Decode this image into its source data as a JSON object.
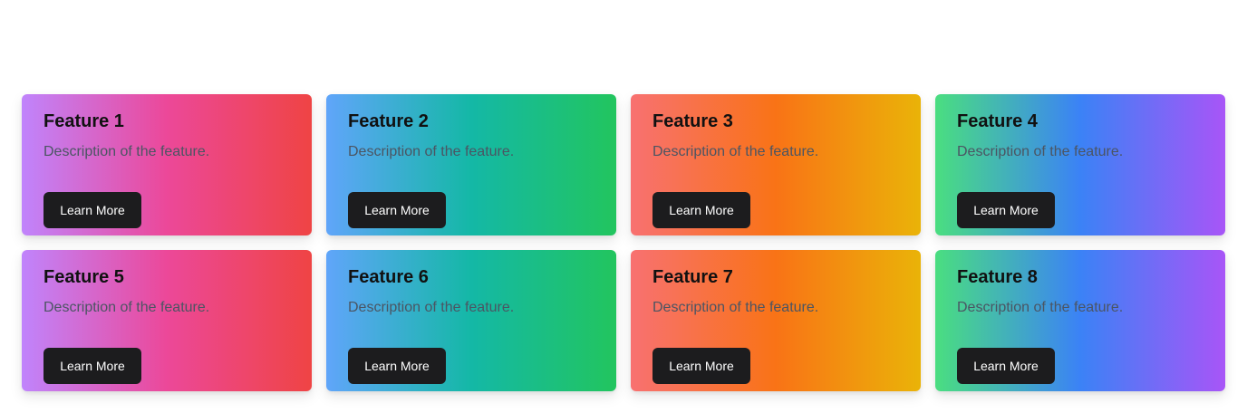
{
  "cards": [
    {
      "title": "Feature 1",
      "description": "Description of the feature.",
      "button_label": "Learn More",
      "gradient": [
        "#c084fc",
        "#ec4899",
        "#ef4444"
      ]
    },
    {
      "title": "Feature 2",
      "description": "Description of the feature.",
      "button_label": "Learn More",
      "gradient": [
        "#60a5fa",
        "#14b8a6",
        "#22c55e"
      ]
    },
    {
      "title": "Feature 3",
      "description": "Description of the feature.",
      "button_label": "Learn More",
      "gradient": [
        "#f87171",
        "#f97316",
        "#eab308"
      ]
    },
    {
      "title": "Feature 4",
      "description": "Description of the feature.",
      "button_label": "Learn More",
      "gradient": [
        "#4ade80",
        "#3b82f6",
        "#a855f7"
      ]
    },
    {
      "title": "Feature 5",
      "description": "Description of the feature.",
      "button_label": "Learn More",
      "gradient": [
        "#c084fc",
        "#ec4899",
        "#ef4444"
      ]
    },
    {
      "title": "Feature 6",
      "description": "Description of the feature.",
      "button_label": "Learn More",
      "gradient": [
        "#60a5fa",
        "#14b8a6",
        "#22c55e"
      ]
    },
    {
      "title": "Feature 7",
      "description": "Description of the feature.",
      "button_label": "Learn More",
      "gradient": [
        "#f87171",
        "#f97316",
        "#eab308"
      ]
    },
    {
      "title": "Feature 8",
      "description": "Description of the feature.",
      "button_label": "Learn More",
      "gradient": [
        "#4ade80",
        "#3b82f6",
        "#a855f7"
      ]
    }
  ],
  "colors": {
    "button_bg": "#1c1c1e",
    "button_text": "#ffffff",
    "title_text": "#111111",
    "description_text": "#4b5563"
  }
}
